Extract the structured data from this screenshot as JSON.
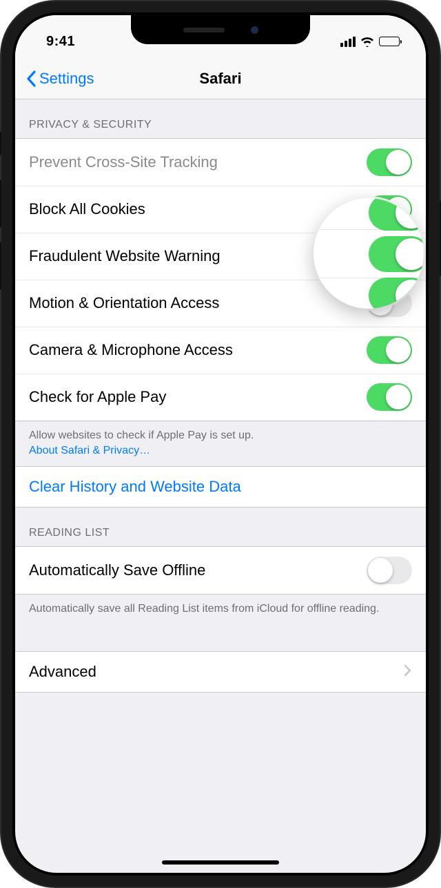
{
  "status": {
    "time": "9:41"
  },
  "nav": {
    "back": "Settings",
    "title": "Safari"
  },
  "sections": {
    "privacy": {
      "header": "Privacy & Security",
      "items": {
        "prevent_tracking": {
          "label": "Prevent Cross-Site Tracking",
          "on": true
        },
        "block_cookies": {
          "label": "Block All Cookies",
          "on": true
        },
        "fraud_warning": {
          "label": "Fraudulent Website Warning",
          "on": true
        },
        "motion_access": {
          "label": "Motion & Orientation Access",
          "on": false
        },
        "camera_mic": {
          "label": "Camera & Microphone Access",
          "on": true
        },
        "apple_pay": {
          "label": "Check for Apple Pay",
          "on": true
        }
      },
      "footer_text": "Allow websites to check if Apple Pay is set up.",
      "footer_link": "About Safari & Privacy…"
    },
    "clear": {
      "label": "Clear History and Website Data"
    },
    "reading": {
      "header": "Reading List",
      "item": {
        "label": "Automatically Save Offline",
        "on": false
      },
      "footer": "Automatically save all Reading List items from iCloud for offline reading."
    },
    "advanced": {
      "label": "Advanced"
    }
  }
}
